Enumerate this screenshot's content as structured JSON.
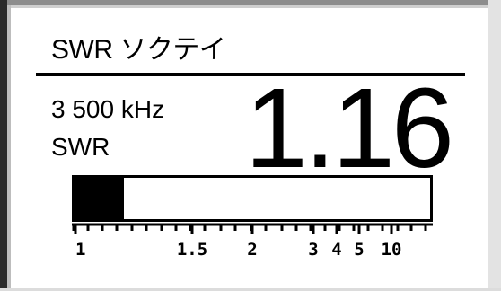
{
  "display": {
    "title": "SWR ソクテイ",
    "frequency": "3 500 kHz",
    "mode_label": "SWR",
    "swr_value": "1.16"
  },
  "meter": {
    "swr": 1.16,
    "fill_fraction": 0.14,
    "scale_labels": [
      "1",
      "1.5",
      "2",
      "3",
      "4",
      "5",
      "10"
    ]
  }
}
